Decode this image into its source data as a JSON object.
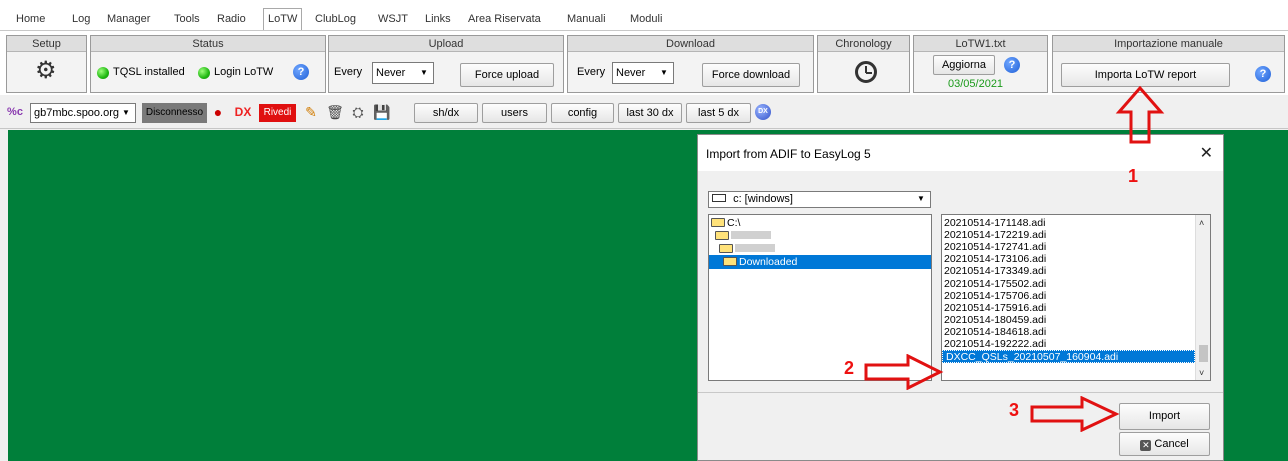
{
  "menu": [
    "Home",
    "Log",
    "Manager",
    "Tools",
    "Radio",
    "LoTW",
    "ClubLog",
    "WSJT",
    "Links",
    "Area Riservata",
    "Manuali",
    "Moduli"
  ],
  "ribbon": {
    "setup": {
      "header": "Setup"
    },
    "status": {
      "header": "Status",
      "tqsl": "TQSL installed",
      "login": "Login LoTW"
    },
    "upload": {
      "header": "Upload",
      "every": "Every",
      "interval": "Never",
      "force": "Force upload"
    },
    "download": {
      "header": "Download",
      "every": "Every",
      "interval": "Never",
      "force": "Force download"
    },
    "chronology": {
      "header": "Chronology"
    },
    "lotw": {
      "header": "LoTW1.txt",
      "refresh": "Aggiorna",
      "date": "03/05/2021"
    },
    "manual": {
      "header": "Importazione manuale",
      "button": "Importa LoTW report"
    }
  },
  "toolbar": {
    "server": "gb7mbc.spoo.org",
    "disconnect": "Disconnesso",
    "dx": "DX",
    "rivedi": "Rivedi",
    "buttons": [
      "sh/dx",
      "users",
      "config",
      "last 30 dx",
      "last 5 dx"
    ]
  },
  "dialog": {
    "title": "Import from ADIF to EasyLog 5",
    "drive": "c: [windows]",
    "folders": [
      "C:\\",
      "Downloaded"
    ],
    "files": [
      "20210514-171148.adi",
      "20210514-172219.adi",
      "20210514-172741.adi",
      "20210514-173106.adi",
      "20210514-173349.adi",
      "20210514-175502.adi",
      "20210514-175706.adi",
      "20210514-175916.adi",
      "20210514-180459.adi",
      "20210514-184618.adi",
      "20210514-192222.adi",
      "DXCC_QSLs_20210507_160904.adi"
    ],
    "import": "Import",
    "cancel": "Cancel"
  },
  "annotations": [
    "1",
    "2",
    "3"
  ],
  "colors": {
    "main_bg": "#007f3a",
    "selection": "#0078d7",
    "annotation": "#e11111"
  }
}
